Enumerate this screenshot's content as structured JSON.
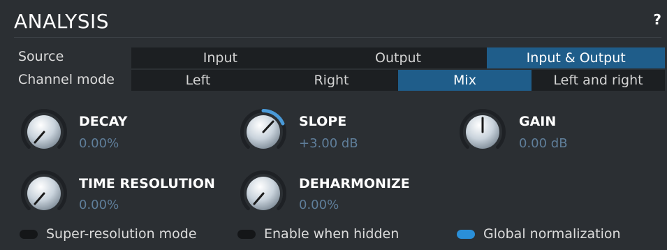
{
  "panel": {
    "title": "ANALYSIS",
    "help": "?"
  },
  "source": {
    "label": "Source",
    "options": [
      "Input",
      "Output",
      "Input & Output"
    ],
    "selected": "Input & Output"
  },
  "channel_mode": {
    "label": "Channel mode",
    "options": [
      "Left",
      "Right",
      "Mix",
      "Left and right"
    ],
    "selected": "Mix"
  },
  "knobs": {
    "decay": {
      "name": "DECAY",
      "value": "0.00%"
    },
    "slope": {
      "name": "SLOPE",
      "value": "+3.00 dB"
    },
    "gain": {
      "name": "GAIN",
      "value": "0.00 dB"
    },
    "time_resolution": {
      "name": "TIME RESOLUTION",
      "value": "0.00%"
    },
    "deharmonize": {
      "name": "DEHARMONIZE",
      "value": "0.00%"
    }
  },
  "toggles": {
    "super_resolution": {
      "label": "Super-resolution mode",
      "on": false
    },
    "enable_when_hidden": {
      "label": "Enable when hidden",
      "on": false
    },
    "global_normalization": {
      "label": "Global normalization",
      "on": true
    }
  },
  "colors": {
    "accent": "#1f5d8a",
    "toggle_on": "#2a8fd8",
    "value_text": "#5f7e9a",
    "background": "#2b2f33"
  }
}
